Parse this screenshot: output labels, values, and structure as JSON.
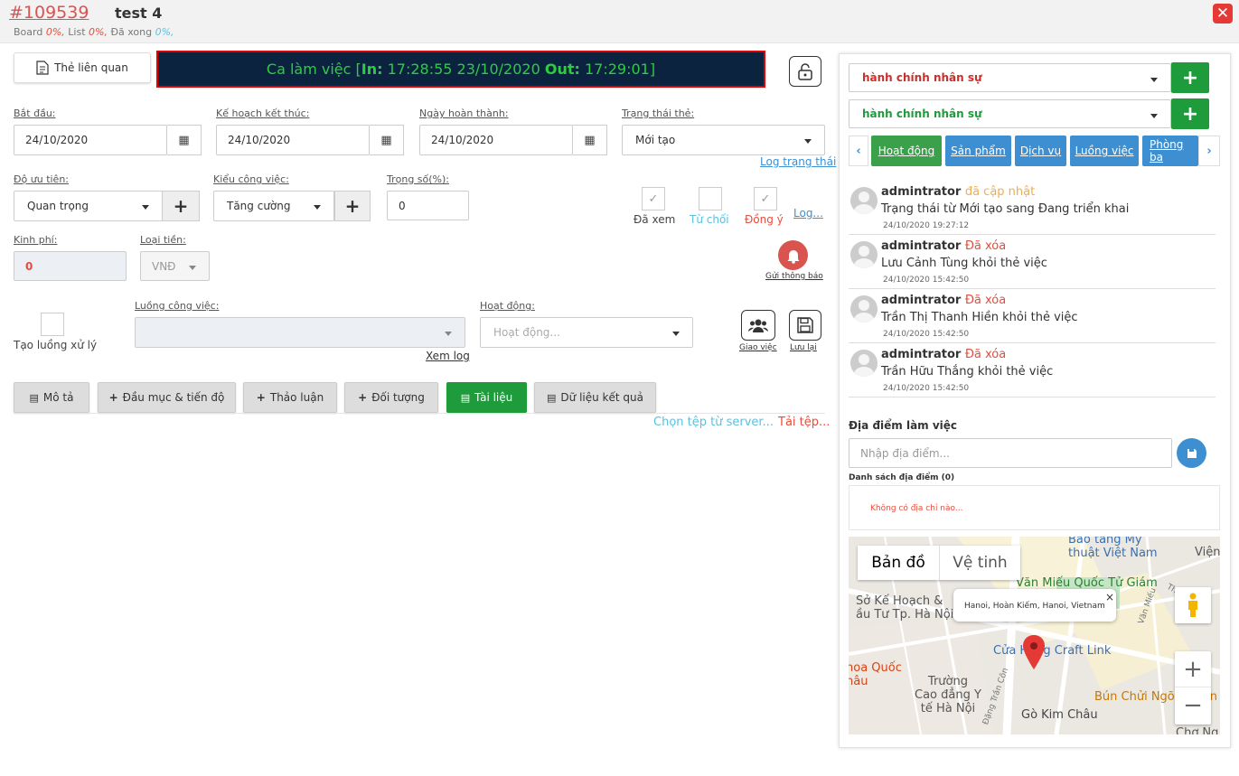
{
  "header": {
    "ticket_id": "#109539",
    "title": "test 4",
    "board_label": "Board",
    "board_val": "0%,",
    "list_label": "List",
    "list_val": "0%,",
    "done_label": "Đã xong",
    "done_val": "0%,"
  },
  "related_label": "Thẻ liên quan",
  "shift": {
    "prefix": "Ca làm việc [",
    "in_label": "In:",
    "in_value": " 17:28:55 23/10/2020 ",
    "out_label": "Out:",
    "out_value": " 17:29:01]"
  },
  "fields": {
    "start_label": "Bắt đầu:",
    "start_value": "24/10/2020",
    "plan_end_label": "Kế hoạch kết thúc:",
    "plan_end_value": "24/10/2020",
    "complete_label": "Ngày hoàn thành:",
    "complete_value": "24/10/2020",
    "status_label": "Trạng thái thẻ:",
    "status_value": "Mới tạo",
    "status_log": "Log trạng thái",
    "priority_label": "Độ ưu tiên:",
    "priority_value": "Quan trọng",
    "worktype_label": "Kiểu công việc:",
    "worktype_value": "Tăng cường",
    "weight_label": "Trọng số(%):",
    "weight_value": "0",
    "seen_label": "Đã xem",
    "reject_label": "Từ chối",
    "agree_label": "Đồng ý",
    "log_label": "Log...",
    "budget_label": "Kinh phí:",
    "budget_value": "0",
    "currency_label": "Loại tiền:",
    "currency_value": "VNĐ",
    "notify_label": "Gửi thông báo",
    "create_flow_label": "Tạo luồng xử lý",
    "workflow_label": "Luồng công việc:",
    "view_log": "Xem log",
    "activity_label": "Hoạt động:",
    "activity_placeholder": "Hoạt động...",
    "assign_label": "Giao việc",
    "save_label": "Lưu lại"
  },
  "tabs": [
    "Mô tả",
    "Đầu mục & tiến độ",
    "Thảo luận",
    "Đối tượng",
    "Tài liệu",
    "Dữ liệu kết quả"
  ],
  "doc_actions": {
    "choose_server": "Chọn tệp từ server...",
    "upload": "Tải tệp..."
  },
  "right": {
    "select1": "hành chính nhân sự",
    "select2": "hành chính nhân sự",
    "tabs": [
      "Hoạt động",
      "Sản phẩm",
      "Dịch vụ",
      "Luồng việc",
      "Phòng ba"
    ],
    "activities": [
      {
        "user": "admintrator",
        "action": "đã cập nhật",
        "desc": "Trạng thái từ Mới tạo sang Đang triển khai",
        "time": "24/10/2020 19:27:12",
        "color": "#f0ad4e"
      },
      {
        "user": "admintrator",
        "action": "Đã xóa",
        "desc": "Lưu Cảnh Tùng khỏi thẻ việc",
        "time": "24/10/2020 15:42:50",
        "color": "#e74c3c"
      },
      {
        "user": "admintrator",
        "action": "Đã xóa",
        "desc": "Trần Thị Thanh Hiền khỏi thẻ việc",
        "time": "24/10/2020 15:42:50",
        "color": "#e74c3c"
      },
      {
        "user": "admintrator",
        "action": "Đã xóa",
        "desc": "Trần Hữu Thắng khỏi thẻ việc",
        "time": "24/10/2020 15:42:50",
        "color": "#e74c3c"
      }
    ],
    "location_title": "Địa điểm làm việc",
    "location_placeholder": "Nhập địa điểm...",
    "list_title": "Danh sách địa điểm (0)",
    "no_address": "Không có địa chỉ nào...",
    "map": {
      "tab_map": "Bản đồ",
      "tab_sat": "Vệ tinh",
      "popup": "Hanoi, Hoàn Kiếm, Hanoi, Vietnam",
      "labels": [
        "Báo tàng Mỹ",
        "thuật Việt Nam",
        "Viện",
        "Văn Miếu Quốc Tử Giám",
        "Văn Miếu",
        "Thanh M",
        "Sở Kế Hoạch &",
        "ầu Tư Tp. Hà Nội",
        "Cửa Hàng Craft Link",
        "hoa Quốc",
        "hâu",
        "Trường",
        "Cao đẳng Y",
        "tế Hà Nội",
        "Đặng Trần Côn",
        "Bún Chửi Ngõ Sĩ Liên",
        "Gò Kim Châu",
        "Chợ Ng"
      ]
    }
  }
}
